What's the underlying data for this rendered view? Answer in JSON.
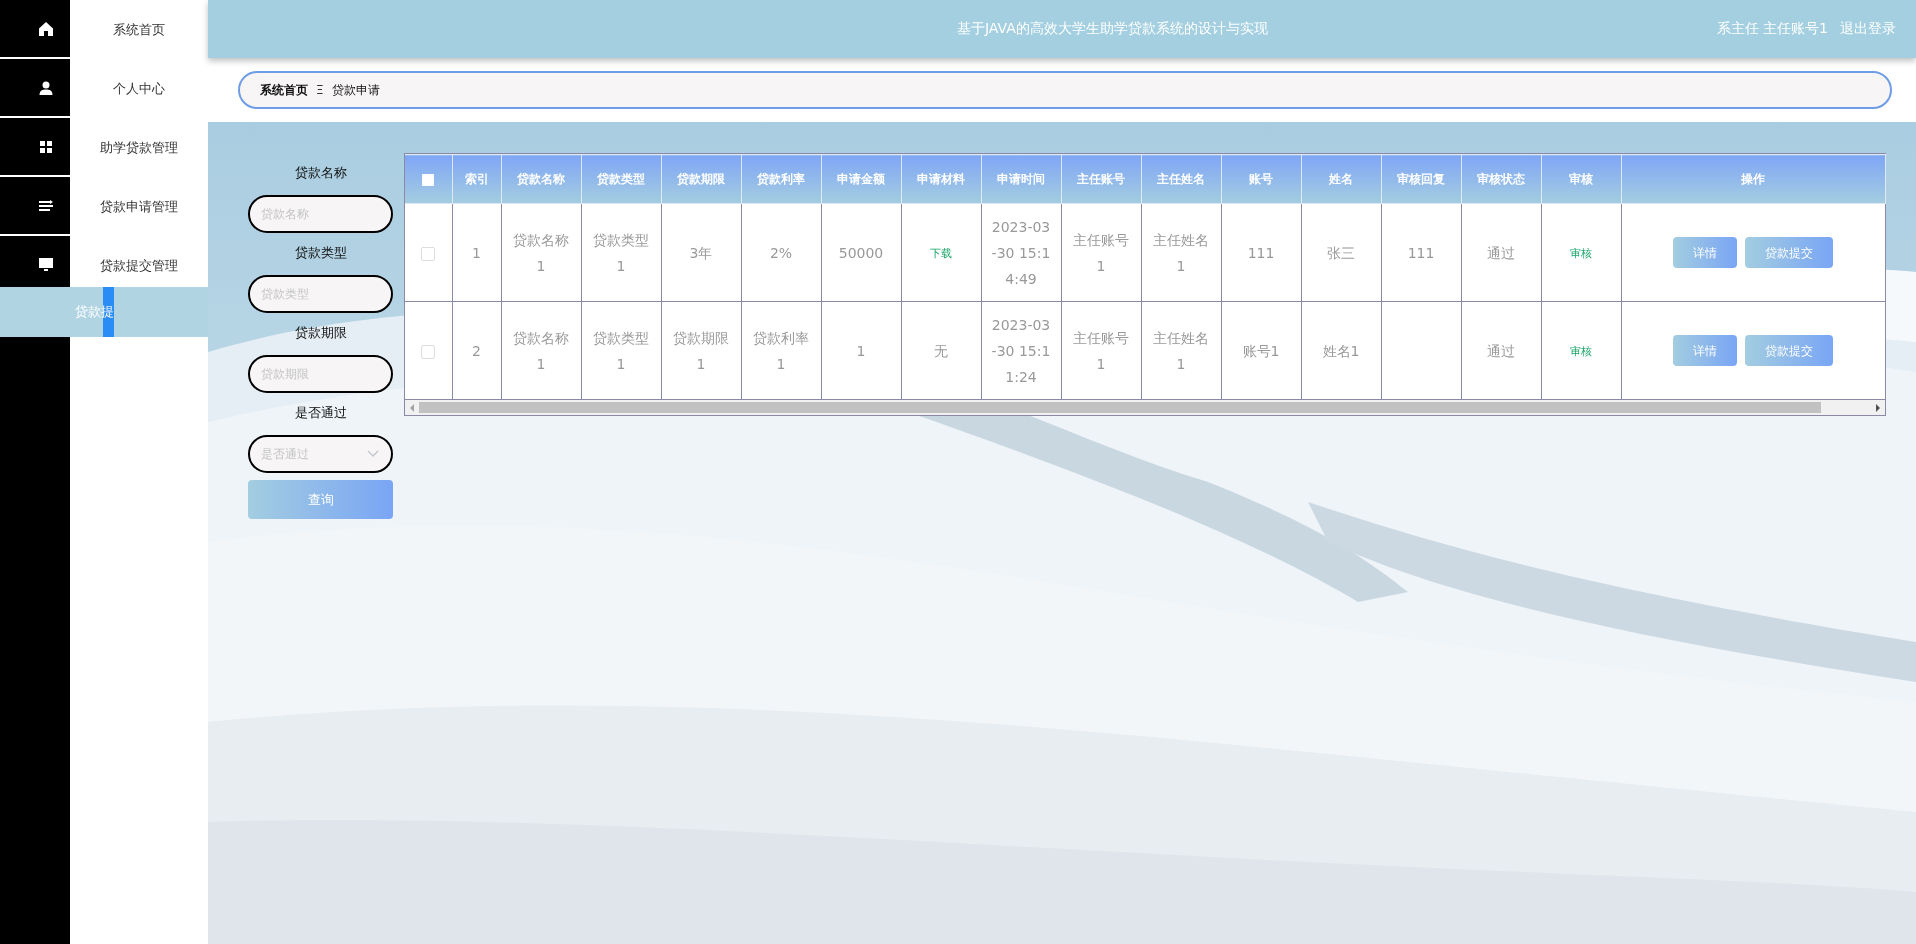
{
  "sidebar": {
    "items": [
      {
        "label": "系统首页",
        "selected": false
      },
      {
        "label": "个人中心",
        "selected": false
      },
      {
        "label": "助学贷款管理",
        "selected": false
      },
      {
        "label": "贷款申请管理",
        "selected": false
      },
      {
        "label": "贷款提交管理",
        "selected": false
      }
    ],
    "flyout": {
      "label": "贷款提"
    }
  },
  "header": {
    "title": "基于JAVA的高效大学生助学贷款系统的设计与实现",
    "user": "系主任 主任账号1",
    "logout": "退出登录"
  },
  "breadcrumb": {
    "items": [
      "系统首页",
      "贷款申请"
    ],
    "separator": "Ξ"
  },
  "search": {
    "fields": [
      {
        "label": "贷款名称",
        "placeholder": "贷款名称",
        "kind": "text"
      },
      {
        "label": "贷款类型",
        "placeholder": "贷款类型",
        "kind": "text"
      },
      {
        "label": "贷款期限",
        "placeholder": "贷款期限",
        "kind": "text"
      },
      {
        "label": "是否通过",
        "placeholder": "是否通过",
        "kind": "select"
      }
    ],
    "button": "查询"
  },
  "table": {
    "all_checked": false,
    "columns": [
      "索引",
      "贷款名称",
      "贷款类型",
      "贷款期限",
      "贷款利率",
      "申请金额",
      "申请材料",
      "申请时间",
      "主任账号",
      "主任姓名",
      "账号",
      "姓名",
      "审核回复",
      "审核状态",
      "审核",
      "操作"
    ],
    "rows": [
      {
        "checked": false,
        "cells": [
          {
            "kind": "text",
            "text": "1"
          },
          {
            "kind": "text",
            "text": "贷款名称1"
          },
          {
            "kind": "text",
            "text": "贷款类型1"
          },
          {
            "kind": "text",
            "text": "3年"
          },
          {
            "kind": "text",
            "text": "2%"
          },
          {
            "kind": "text",
            "text": "50000"
          },
          {
            "kind": "link",
            "text": "下载"
          },
          {
            "kind": "text",
            "text": "2023-03-30 15:14:49"
          },
          {
            "kind": "text",
            "text": "主任账号1"
          },
          {
            "kind": "text",
            "text": "主任姓名1"
          },
          {
            "kind": "text",
            "text": "111"
          },
          {
            "kind": "text",
            "text": "张三"
          },
          {
            "kind": "text",
            "text": "111"
          },
          {
            "kind": "text",
            "text": "通过"
          },
          {
            "kind": "link",
            "text": "审核"
          }
        ],
        "actions": [
          "详情",
          "贷款提交"
        ]
      },
      {
        "checked": false,
        "cells": [
          {
            "kind": "text",
            "text": "2"
          },
          {
            "kind": "text",
            "text": "贷款名称1"
          },
          {
            "kind": "text",
            "text": "贷款类型1"
          },
          {
            "kind": "text",
            "text": "贷款期限1"
          },
          {
            "kind": "text",
            "text": "贷款利率1"
          },
          {
            "kind": "text",
            "text": "1"
          },
          {
            "kind": "text",
            "text": "无"
          },
          {
            "kind": "text",
            "text": "2023-03-30 15:11:24"
          },
          {
            "kind": "text",
            "text": "主任账号1"
          },
          {
            "kind": "text",
            "text": "主任姓名1"
          },
          {
            "kind": "text",
            "text": "账号1"
          },
          {
            "kind": "text",
            "text": "姓名1"
          },
          {
            "kind": "empty"
          },
          {
            "kind": "text",
            "text": "通过"
          },
          {
            "kind": "link",
            "text": "审核"
          }
        ],
        "actions": [
          "详情",
          "贷款提交"
        ]
      }
    ]
  }
}
